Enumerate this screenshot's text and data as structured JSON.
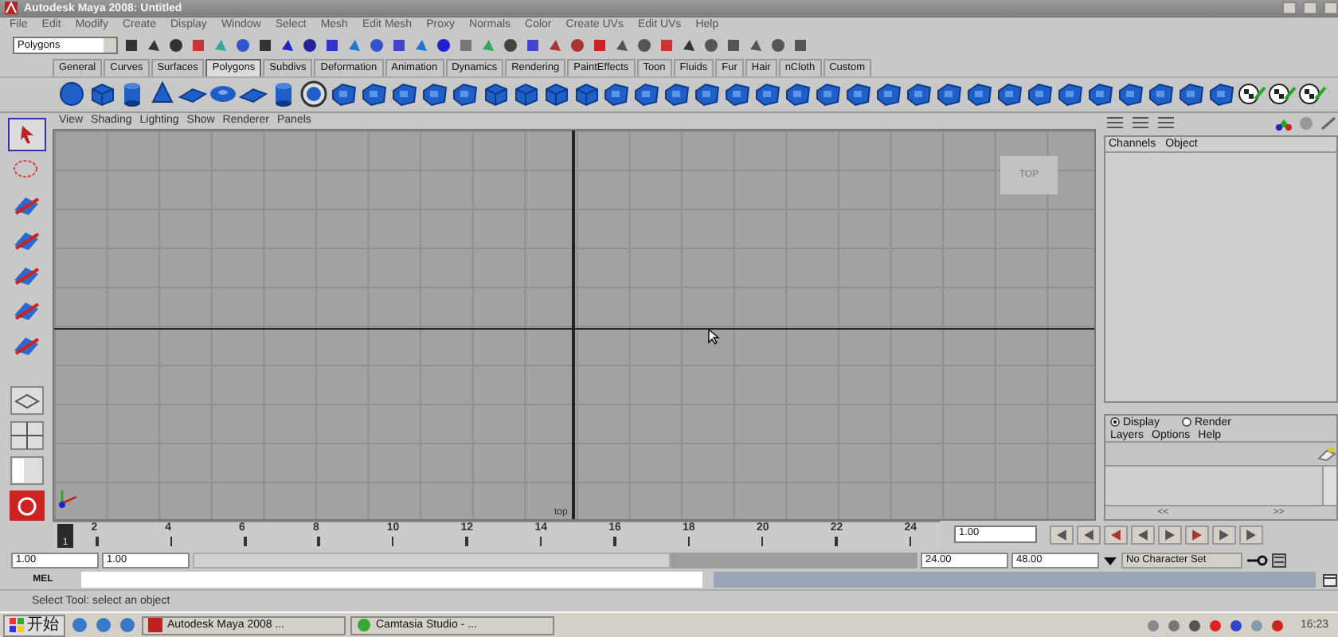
{
  "window": {
    "title": "Autodesk Maya 2008:  Untitled"
  },
  "menu_bar": [
    "File",
    "Edit",
    "Modify",
    "Create",
    "Display",
    "Window",
    "Select",
    "Mesh",
    "Edit Mesh",
    "Proxy",
    "Normals",
    "Color",
    "Create UVs",
    "Edit UVs",
    "Help"
  ],
  "status_line": {
    "menu_set": "Polygons"
  },
  "shelf": {
    "tabs": [
      {
        "label": "General",
        "selected": false
      },
      {
        "label": "Curves",
        "selected": false
      },
      {
        "label": "Surfaces",
        "selected": false
      },
      {
        "label": "Polygons",
        "selected": true
      },
      {
        "label": "Subdivs",
        "selected": false
      },
      {
        "label": "Deformation",
        "selected": false
      },
      {
        "label": "Animation",
        "selected": false
      },
      {
        "label": "Dynamics",
        "selected": false
      },
      {
        "label": "Rendering",
        "selected": false
      },
      {
        "label": "PaintEffects",
        "selected": false
      },
      {
        "label": "Toon",
        "selected": false
      },
      {
        "label": "Fluids",
        "selected": false
      },
      {
        "label": "Fur",
        "selected": false
      },
      {
        "label": "Hair",
        "selected": false
      },
      {
        "label": "nCloth",
        "selected": false
      },
      {
        "label": "Custom",
        "selected": false
      }
    ]
  },
  "panel_menu": [
    "View",
    "Shading",
    "Lighting",
    "Show",
    "Renderer",
    "Panels"
  ],
  "viewport": {
    "view_label": "TOP",
    "camera_name": "top"
  },
  "channel_box": {
    "menu": [
      "Channels",
      "Object"
    ]
  },
  "layer_editor": {
    "modes": [
      {
        "label": "Display",
        "selected": true
      },
      {
        "label": "Render",
        "selected": false
      }
    ],
    "menu": [
      "Layers",
      "Options",
      "Help"
    ],
    "scroll_left": "<<",
    "scroll_right": ">>"
  },
  "time_slider": {
    "ticks": [
      "2",
      "4",
      "6",
      "8",
      "10",
      "12",
      "14",
      "16",
      "18",
      "20",
      "22",
      "24"
    ],
    "current_frame": "1",
    "level": 0,
    "current_time": "1.00"
  },
  "range_slider": {
    "start_time": "1.00",
    "playback_start": "1.00",
    "playback_end": "24.00",
    "end_time": "48.00",
    "level": 0.66,
    "character_set": "No Character Set"
  },
  "command_line": {
    "label": "MEL"
  },
  "help_line": "Select Tool: select an object",
  "taskbar": {
    "start": "开始",
    "tasks": [
      "Autodesk Maya 2008 ...",
      "Camtasia Studio - ..."
    ],
    "clock": "16:23"
  }
}
